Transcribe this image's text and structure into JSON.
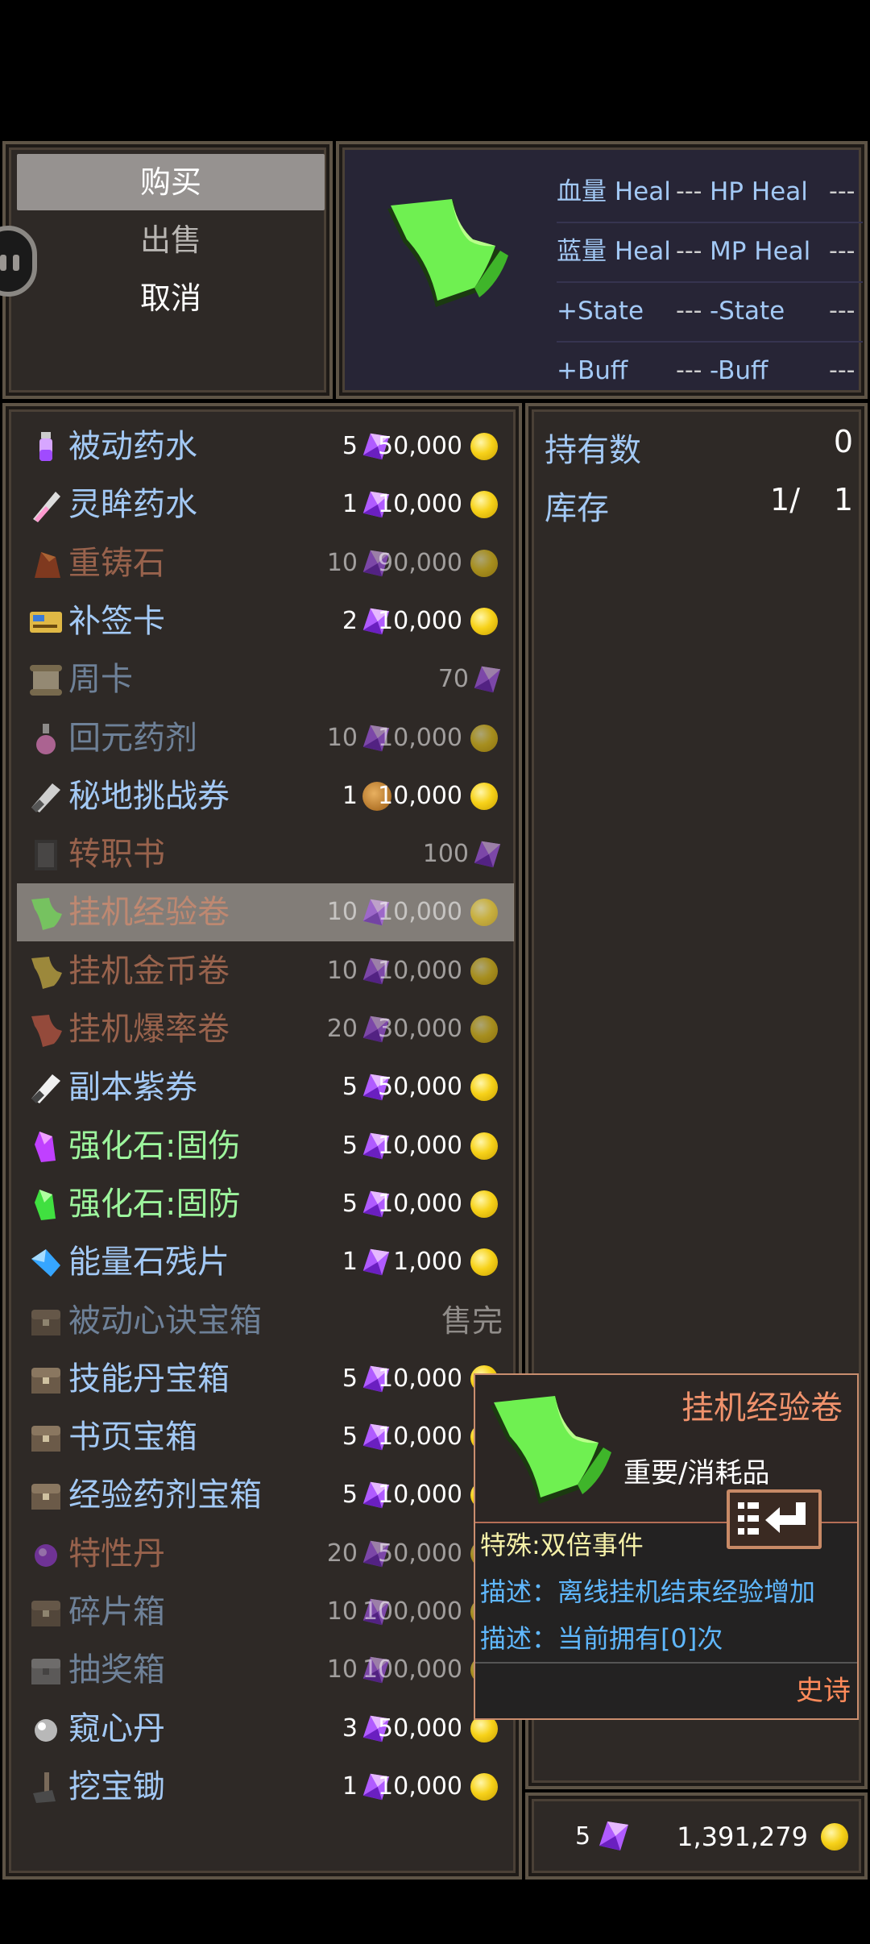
{
  "command_menu": {
    "items": [
      {
        "label": "购买",
        "selected": true
      },
      {
        "label": "出售",
        "selected": false
      },
      {
        "label": "取消",
        "selected": false
      }
    ]
  },
  "status": {
    "rows": [
      {
        "left_label": "血量 Heal",
        "left_value": "---",
        "right_label": "HP Heal",
        "right_value": "---"
      },
      {
        "left_label": "蓝量 Heal",
        "left_value": "---",
        "right_label": "MP Heal",
        "right_value": "---"
      },
      {
        "left_label": "+State",
        "left_value": "---",
        "right_label": "-State",
        "right_value": "---"
      },
      {
        "left_label": "+Buff",
        "left_value": "---",
        "right_label": "-Buff",
        "right_value": "---"
      }
    ]
  },
  "items": [
    {
      "name": "被动药水",
      "qty": "5",
      "price": "50,000",
      "color": "#a3c9f5",
      "icon": "potion-icon",
      "dim": false
    },
    {
      "name": "灵眸药水",
      "qty": "1",
      "price": "10,000",
      "color": "#a3c9f5",
      "icon": "vial-icon",
      "dim": false
    },
    {
      "name": "重铸石",
      "qty": "10",
      "price": "90,000",
      "color": "#f0926c",
      "icon": "stone-icon",
      "dim": true
    },
    {
      "name": "补签卡",
      "qty": "2",
      "price": "10,000",
      "color": "#a3c9f5",
      "icon": "card-icon",
      "dim": false
    },
    {
      "name": "周卡",
      "qty": "70",
      "price": "",
      "color": "#a3c9f5",
      "icon": "scroll-icon",
      "dim": true
    },
    {
      "name": "回元药剂",
      "qty": "10",
      "price": "10,000",
      "color": "#a3c9f5",
      "icon": "flask-icon",
      "dim": true
    },
    {
      "name": "秘地挑战券",
      "qty": "1",
      "price": "10,000",
      "color": "#a3c9f5",
      "icon": "ticket-icon",
      "dim": false
    },
    {
      "name": "转职书",
      "qty": "100",
      "price": "",
      "color": "#f0926c",
      "icon": "book-icon",
      "dim": true
    },
    {
      "name": "挂机经验卷",
      "qty": "10",
      "price": "10,000",
      "color": "#f0926c",
      "icon": "green-scroll-icon",
      "dim": true,
      "selected": true
    },
    {
      "name": "挂机金币卷",
      "qty": "10",
      "price": "10,000",
      "color": "#f0926c",
      "icon": "gold-scroll-icon",
      "dim": true
    },
    {
      "name": "挂机爆率卷",
      "qty": "20",
      "price": "30,000",
      "color": "#f0926c",
      "icon": "red-scroll-icon",
      "dim": true
    },
    {
      "name": "副本紫券",
      "qty": "5",
      "price": "50,000",
      "color": "#a3c9f5",
      "icon": "purple-ticket-icon",
      "dim": false
    },
    {
      "name": "强化石:固伤",
      "qty": "5",
      "price": "10,000",
      "color": "#9df59d",
      "icon": "purple-gem-icon",
      "dim": false
    },
    {
      "name": "强化石:固防",
      "qty": "5",
      "price": "10,000",
      "color": "#9df59d",
      "icon": "green-gem-icon",
      "dim": false
    },
    {
      "name": "能量石残片",
      "qty": "1",
      "price": "1,000",
      "color": "#a3c9f5",
      "icon": "shard-icon",
      "dim": false
    },
    {
      "name": "被动心诀宝箱",
      "qty": "",
      "price": "",
      "soldout": "售完",
      "color": "#a3c9f5",
      "icon": "chest-icon",
      "dim": true
    },
    {
      "name": "技能丹宝箱",
      "qty": "5",
      "price": "10,000",
      "color": "#a3c9f5",
      "icon": "chest-icon",
      "dim": false
    },
    {
      "name": "书页宝箱",
      "qty": "5",
      "price": "10,000",
      "color": "#a3c9f5",
      "icon": "chest-icon",
      "dim": false
    },
    {
      "name": "经验药剂宝箱",
      "qty": "5",
      "price": "10,000",
      "color": "#a3c9f5",
      "icon": "chest-icon",
      "dim": false
    },
    {
      "name": "特性丹",
      "qty": "20",
      "price": "50,000",
      "color": "#f0926c",
      "icon": "pill-icon",
      "dim": true
    },
    {
      "name": "碎片箱",
      "qty": "10",
      "price": "100,000",
      "color": "#a3c9f5",
      "icon": "chest-icon",
      "dim": true
    },
    {
      "name": "抽奖箱",
      "qty": "10",
      "price": "100,000",
      "color": "#a3c9f5",
      "icon": "lottery-chest-icon",
      "dim": true
    },
    {
      "name": "窥心丹",
      "qty": "3",
      "price": "50,000",
      "color": "#a3c9f5",
      "icon": "orb-icon",
      "dim": false
    },
    {
      "name": "挖宝锄",
      "qty": "1",
      "price": "10,000",
      "color": "#a3c9f5",
      "icon": "hoe-icon",
      "dim": false
    }
  ],
  "hold": {
    "owned_label": "持有数",
    "owned_value": "0",
    "stock_label": "库存",
    "stock_value": "1/",
    "stock_total": "1"
  },
  "currency": {
    "gems": "5",
    "gold": "1,391,279"
  },
  "tooltip": {
    "title": "挂机经验卷",
    "type": "重要/消耗品",
    "special": "特殊:双倍事件",
    "desc1": "描述：离线挂机结束经验增加",
    "desc2": "描述：当前拥有[0]次",
    "rarity": "史诗"
  },
  "colors": {
    "info_blue": "#a3c9f5",
    "rare_orange": "#f0926c",
    "green": "#9df59d",
    "panel": "#2e2926",
    "border": "#5e5446"
  }
}
